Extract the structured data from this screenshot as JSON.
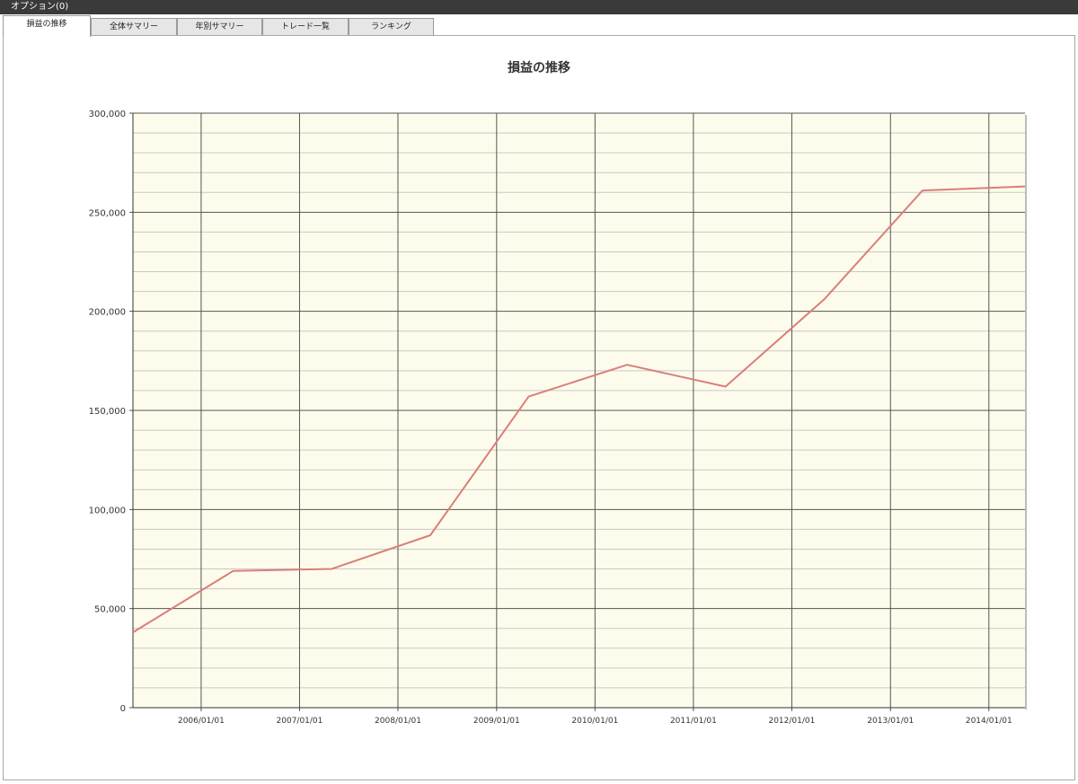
{
  "window": {
    "title": "オプション(0)"
  },
  "tabs": [
    {
      "label": "損益の推移",
      "active": true
    },
    {
      "label": "全体サマリー",
      "active": false
    },
    {
      "label": "年別サマリー",
      "active": false
    },
    {
      "label": "トレード一覧",
      "active": false
    },
    {
      "label": "ランキング",
      "active": false
    }
  ],
  "colors": {
    "plot_background": "#fdfcec",
    "line": "#d97f78",
    "major_grid": "#555555",
    "minor_grid": "#c8c8c8"
  },
  "chart_data": {
    "type": "line",
    "title": "損益の推移",
    "xlabel": "",
    "ylabel": "",
    "ylim": [
      0,
      300000
    ],
    "xlim": [
      "2005-04-23",
      "2014-05-15"
    ],
    "yticks": [
      0,
      50000,
      100000,
      150000,
      200000,
      250000,
      300000
    ],
    "ytick_labels": [
      "0",
      "50,000",
      "100,000",
      "150,000",
      "200,000",
      "250,000",
      "300,000"
    ],
    "xticks": [
      "2006-01-01",
      "2007-01-01",
      "2008-01-01",
      "2009-01-01",
      "2010-01-01",
      "2011-01-01",
      "2012-01-01",
      "2013-01-01",
      "2014-01-01"
    ],
    "xtick_labels": [
      "2006/01/01",
      "2007/01/01",
      "2008/01/01",
      "2009/01/01",
      "2010/01/01",
      "2011/01/01",
      "2012/01/01",
      "2013/01/01",
      "2014/01/01"
    ],
    "grid": true,
    "legend": "none",
    "series": [
      {
        "x": [
          "2005-04-23",
          "2006-04-30",
          "2007-04-30",
          "2008-04-30",
          "2009-04-30",
          "2010-04-30",
          "2011-04-30",
          "2012-04-30",
          "2013-04-30",
          "2014-05-15"
        ],
        "y": [
          38000,
          69000,
          70000,
          87000,
          157000,
          173000,
          162000,
          206000,
          261000,
          263000
        ]
      }
    ]
  }
}
